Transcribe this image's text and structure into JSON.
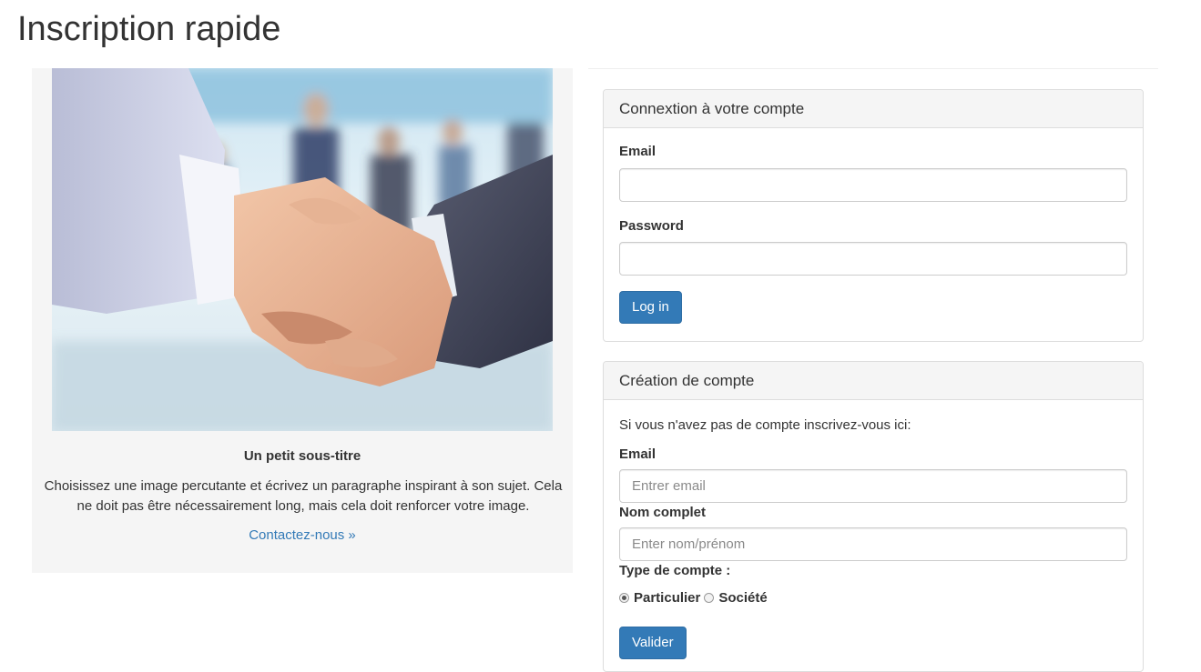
{
  "page": {
    "title": "Inscription rapide"
  },
  "promo": {
    "image_icon": "handshake-photo",
    "subtitle": "Un petit sous-titre",
    "paragraph": "Choisissez une image percutante et écrivez un paragraphe inspirant à son sujet. Cela ne doit pas être nécessairement long, mais cela doit renforcer votre image.",
    "link_label": "Contactez-nous »"
  },
  "login": {
    "heading": "Connextion à votre compte",
    "email_label": "Email",
    "email_value": "",
    "password_label": "Password",
    "password_value": "",
    "submit_label": "Log in"
  },
  "register": {
    "heading": "Création de compte",
    "intro": "Si vous n'avez pas de compte inscrivez-vous ici:",
    "email_label": "Email",
    "email_placeholder": "Entrer email",
    "name_label": "Nom complet",
    "name_placeholder": "Enter nom/prénom",
    "type_label": "Type de compte :",
    "type_options": [
      {
        "label": "Particulier",
        "checked": true
      },
      {
        "label": "Société",
        "checked": false
      }
    ],
    "submit_label": "Valider"
  },
  "colors": {
    "primary": "#337ab7",
    "link": "#337ab7",
    "panel_bg": "#f5f5f5"
  }
}
